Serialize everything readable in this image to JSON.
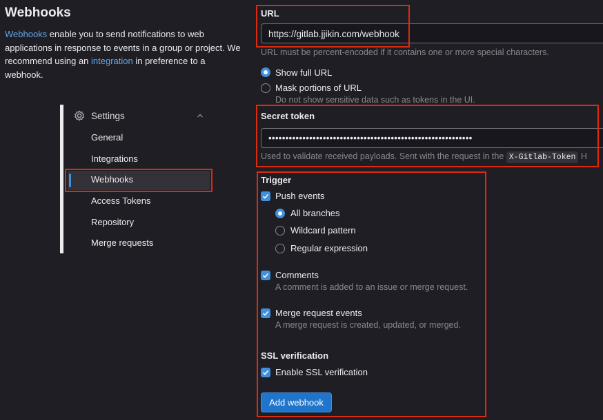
{
  "header": {
    "title": "Webhooks",
    "intro_link": "Webhooks",
    "intro_text_1": " enable you to send notifications to web applications in response to events in a group or project. We recommend using an ",
    "intro_link_2": "integration",
    "intro_text_2": " in preference to a webhook."
  },
  "sidebar": {
    "section_label": "Settings",
    "section_icon": "gear-icon",
    "items": [
      {
        "label": "General"
      },
      {
        "label": "Integrations"
      },
      {
        "label": "Webhooks",
        "active": true
      },
      {
        "label": "Access Tokens"
      },
      {
        "label": "Repository"
      },
      {
        "label": "Merge requests"
      }
    ]
  },
  "url": {
    "label": "URL",
    "value": "https://gitlab.jjikin.com/webhook",
    "help": "URL must be percent-encoded if it contains one or more special characters.",
    "options": [
      {
        "label": "Show full URL",
        "selected": true
      },
      {
        "label": "Mask portions of URL",
        "selected": false,
        "help": "Do not show sensitive data such as tokens in the UI."
      }
    ]
  },
  "secret": {
    "label": "Secret token",
    "value": "••••••••••••••••••••••••••••••••••••••••••••••••••••••••••••",
    "help": "Used to validate received payloads. Sent with the request in the",
    "help_code": "X-Gitlab-Token",
    "help_tail": "H"
  },
  "trigger": {
    "label": "Trigger",
    "push": {
      "label": "Push events",
      "checked": true
    },
    "branches": [
      {
        "label": "All branches",
        "selected": true
      },
      {
        "label": "Wildcard pattern",
        "selected": false
      },
      {
        "label": "Regular expression",
        "selected": false
      }
    ],
    "comments": {
      "label": "Comments",
      "help": "A comment is added to an issue or merge request.",
      "checked": true
    },
    "merge": {
      "label": "Merge request events",
      "help": "A merge request is created, updated, or merged.",
      "checked": true
    }
  },
  "ssl": {
    "label": "SSL verification",
    "option": "Enable SSL verification",
    "checked": true
  },
  "actions": {
    "add_label": "Add webhook"
  },
  "colors": {
    "background": "#1f1e24",
    "accent": "#428fdc",
    "button": "#1f75cb",
    "highlight_box": "#dd2b0e",
    "link": "#63a6e9"
  }
}
